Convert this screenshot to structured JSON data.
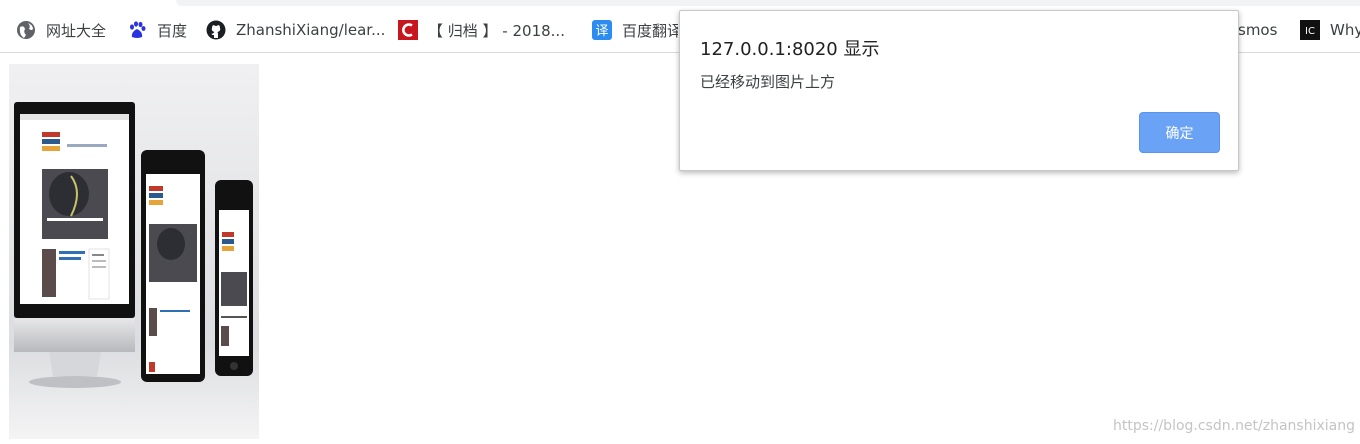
{
  "bookmarks": [
    {
      "label": "网址大全",
      "icon": "globe-icon"
    },
    {
      "label": "百度",
      "icon": "baidu-paw-icon"
    },
    {
      "label": "ZhanshiXiang/lear...",
      "icon": "github-icon"
    },
    {
      "label": "【 归档 】 - 2018...",
      "icon": "csdn-icon"
    },
    {
      "label": "百度翻译",
      "icon": "translate-icon"
    },
    {
      "label": "smos",
      "icon": ""
    },
    {
      "label": "Why",
      "icon": "why-icon"
    }
  ],
  "alert": {
    "title": "127.0.0.1:8020 显示",
    "message": "已经移动到图片上方",
    "ok_label": "确定"
  },
  "watermark": "https://blog.csdn.net/zhanshixiang",
  "colors": {
    "ok_button": "#6aa3f5",
    "csdn_red": "#c8161d",
    "translate_blue": "#2d8cf0"
  }
}
